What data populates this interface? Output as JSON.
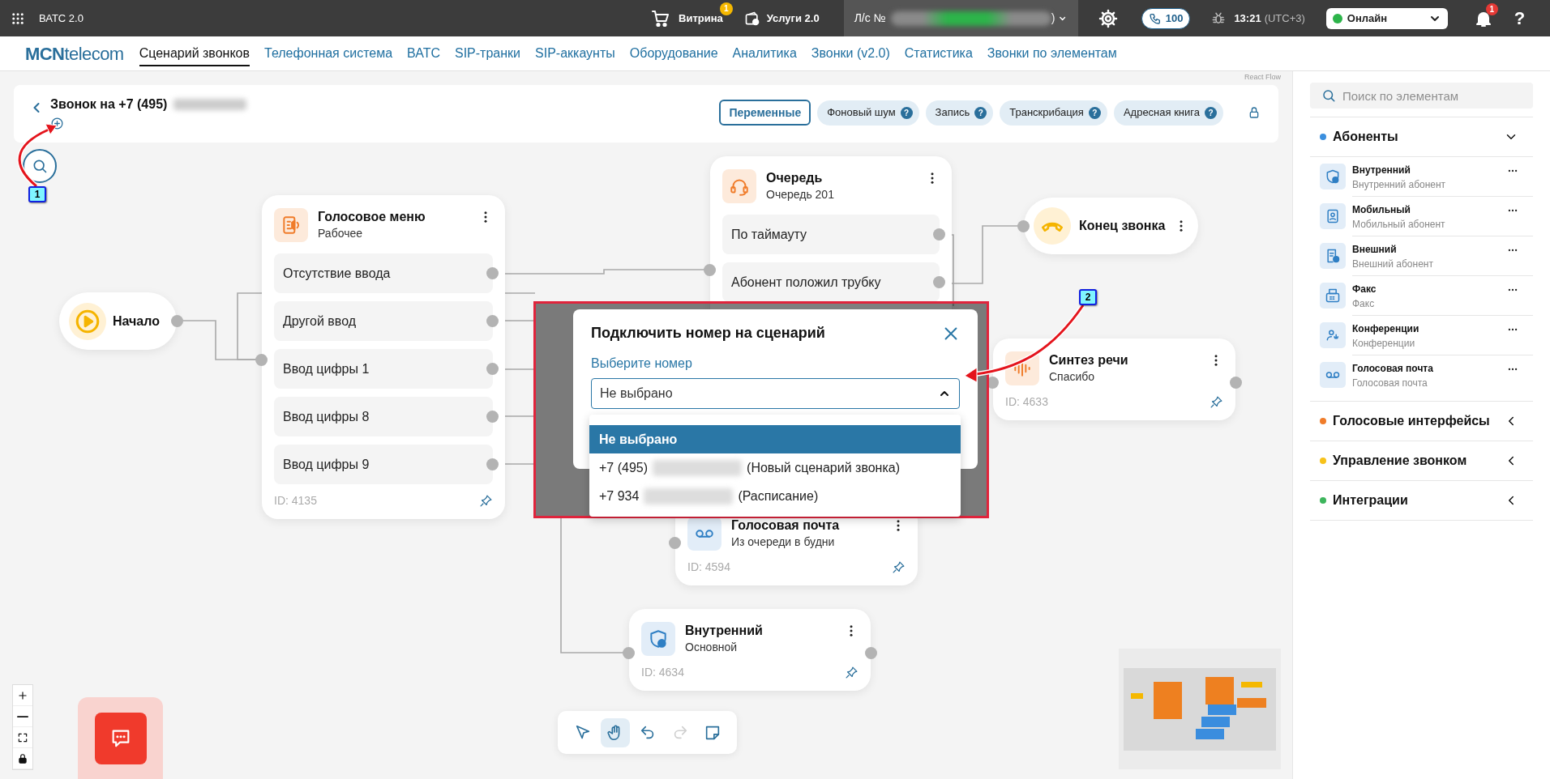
{
  "topbar": {
    "app_title": "ВАТС 2.0",
    "showcase": {
      "label": "Витрина",
      "badge": "1"
    },
    "services": {
      "label": "Услуги 2.0"
    },
    "account": {
      "prefix": "Л/с №",
      "suffix": ")"
    },
    "calls": {
      "count": "100"
    },
    "clock": {
      "time": "13:21",
      "timezone": "(UTC+3)"
    },
    "status": {
      "value": "Онлайн"
    },
    "notifications": {
      "badge": "1"
    },
    "help": "?"
  },
  "nav": {
    "logo": {
      "bold": "MCN",
      "rest": "telecom"
    },
    "items": [
      {
        "label": "Сценарий звонков",
        "selected": true
      },
      {
        "label": "Телефонная система",
        "selected": false
      },
      {
        "label": "ВАТС",
        "selected": false
      },
      {
        "label": "SIP-транки",
        "selected": false
      },
      {
        "label": "SIP-аккаунты",
        "selected": false
      },
      {
        "label": "Оборудование",
        "selected": false
      },
      {
        "label": "Аналитика",
        "selected": false
      },
      {
        "label": "Звонки (v2.0)",
        "selected": false
      },
      {
        "label": "Статистика",
        "selected": false
      },
      {
        "label": "Звонки по элементам",
        "selected": false
      }
    ]
  },
  "scenario": {
    "title": "Звонок на +7 (495)",
    "chips": [
      {
        "label": "Переменные",
        "kind": "primary"
      },
      {
        "label": "Фоновый шум",
        "kind": "help",
        "help": "?"
      },
      {
        "label": "Запись",
        "kind": "help",
        "help": "?"
      },
      {
        "label": "Транскрибация",
        "kind": "help",
        "help": "?"
      },
      {
        "label": "Адресная книга",
        "kind": "help",
        "help": "?"
      }
    ]
  },
  "canvas": {
    "watermark": "React Flow",
    "nodes": [
      {
        "kind": "start",
        "title": "Начало"
      },
      {
        "kind": "voice_menu",
        "title": "Голосовое меню",
        "subtitle": "Рабочее",
        "outputs": [
          "Отсутствие ввода",
          "Другой ввод",
          "Ввод цифры 1",
          "Ввод цифры 8",
          "Ввод цифры 9"
        ],
        "id_label": "ID: 4135"
      },
      {
        "kind": "queue",
        "title": "Очередь",
        "subtitle": "Очередь 201",
        "outputs": [
          "По таймауту",
          "Абонент положил трубку"
        ]
      },
      {
        "kind": "end",
        "title": "Конец звонка"
      },
      {
        "kind": "tts",
        "title": "Синтез речи",
        "subtitle": "Спасибо",
        "id_label": "ID: 4633"
      },
      {
        "kind": "voicemail",
        "title": "Голосовая почта",
        "subtitle": "Из очереди в будни",
        "id_label": "ID: 4594"
      },
      {
        "kind": "internal",
        "title": "Внутренний",
        "subtitle": "Основной",
        "id_label": "ID: 4634"
      }
    ]
  },
  "modal": {
    "title": "Подключить номер на сценарий",
    "field_label": "Выберите номер",
    "value": "Не выбрано",
    "expanded": true,
    "options": [
      {
        "parts": [
          "Не выбрано"
        ],
        "selected": true
      },
      {
        "parts": [
          "+7 (495)",
          "(Новый сценарий звонка)"
        ],
        "selected": false
      },
      {
        "parts": [
          "+7 934",
          "(Расписание)"
        ],
        "selected": false
      }
    ]
  },
  "toolbar": [
    {
      "kind": "select",
      "selected": false,
      "disabled": false
    },
    {
      "kind": "pan",
      "selected": true,
      "disabled": false
    },
    {
      "kind": "undo",
      "selected": false,
      "disabled": false
    },
    {
      "kind": "redo",
      "selected": false,
      "disabled": true
    },
    {
      "kind": "note",
      "selected": false,
      "disabled": false
    }
  ],
  "zoom_controls": [
    {
      "kind": "zoom_in"
    },
    {
      "kind": "zoom_out"
    },
    {
      "kind": "fit"
    },
    {
      "kind": "lock"
    }
  ],
  "sidebar": {
    "search_placeholder": "Поиск по элементам",
    "groups": [
      {
        "title": "Абоненты",
        "color": "#3b8fde",
        "expanded": true,
        "items": [
          {
            "kind": "internal",
            "title": "Внутренний",
            "subtitle": "Внутренний абонент"
          },
          {
            "kind": "mobile",
            "title": "Мобильный",
            "subtitle": "Мобильный абонент"
          },
          {
            "kind": "external",
            "title": "Внешний",
            "subtitle": "Внешний абонент"
          },
          {
            "kind": "fax",
            "title": "Факс",
            "subtitle": "Факс"
          },
          {
            "kind": "conference",
            "title": "Конференции",
            "subtitle": "Конференции"
          },
          {
            "kind": "voicemail",
            "title": "Голосовая почта",
            "subtitle": "Голосовая почта"
          }
        ]
      },
      {
        "title": "Голосовые интерфейсы",
        "color": "#f07c2a",
        "expanded": false
      },
      {
        "title": "Управление звонком",
        "color": "#f7c21a",
        "expanded": false
      },
      {
        "title": "Интеграции",
        "color": "#3db55c",
        "expanded": false
      }
    ]
  },
  "annotations": [
    {
      "label": "1"
    },
    {
      "label": "2"
    }
  ]
}
